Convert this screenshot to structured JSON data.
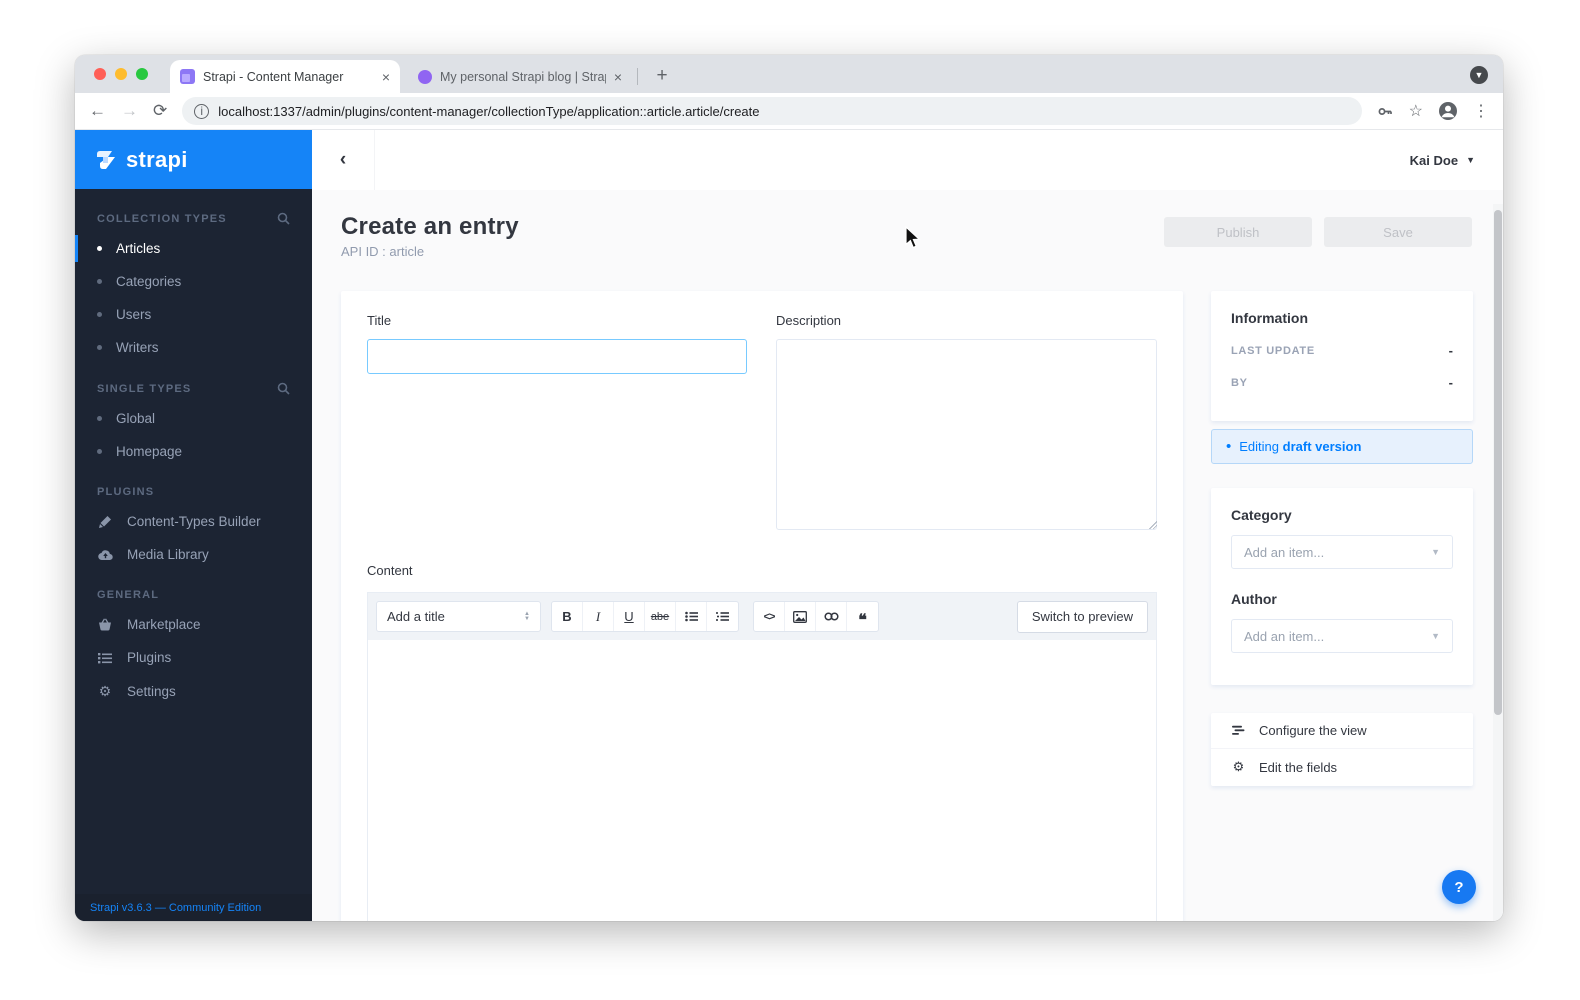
{
  "browser": {
    "tabs": [
      {
        "title": "Strapi - Content Manager"
      },
      {
        "title": "My personal Strapi blog | Strap"
      }
    ],
    "url": "localhost:1337/admin/plugins/content-manager/collectionType/application::article.article/create"
  },
  "sidebar": {
    "logo": "strapi",
    "sections": [
      {
        "label": "COLLECTION TYPES",
        "items": [
          {
            "label": "Articles"
          },
          {
            "label": "Categories"
          },
          {
            "label": "Users"
          },
          {
            "label": "Writers"
          }
        ]
      },
      {
        "label": "SINGLE TYPES",
        "items": [
          {
            "label": "Global"
          },
          {
            "label": "Homepage"
          }
        ]
      },
      {
        "label": "PLUGINS",
        "items": [
          {
            "label": "Content-Types Builder"
          },
          {
            "label": "Media Library"
          }
        ]
      },
      {
        "label": "GENERAL",
        "items": [
          {
            "label": "Marketplace"
          },
          {
            "label": "Plugins"
          },
          {
            "label": "Settings"
          }
        ]
      }
    ],
    "footer": "Strapi v3.6.3 — Community Edition"
  },
  "header": {
    "user": "Kai Doe"
  },
  "page": {
    "title": "Create an entry",
    "subtitle": "API ID : article",
    "publish": "Publish",
    "save": "Save"
  },
  "form": {
    "title_label": "Title",
    "description_label": "Description",
    "content_label": "Content",
    "editor": {
      "heading": "Add a title",
      "bold": "B",
      "italic": "I",
      "underline": "U",
      "strike": "abe",
      "code": "<>",
      "quote": "❝",
      "switch": "Switch to preview"
    }
  },
  "panels": {
    "information": {
      "title": "Information",
      "last_update_label": "LAST UPDATE",
      "last_update_value": "-",
      "by_label": "BY",
      "by_value": "-"
    },
    "draft": {
      "prefix": "Editing",
      "emphasis": "draft version"
    },
    "category": {
      "title": "Category",
      "placeholder": "Add an item..."
    },
    "author": {
      "title": "Author",
      "placeholder": "Add an item..."
    },
    "links": [
      {
        "label": "Configure the view"
      },
      {
        "label": "Edit the fields"
      }
    ]
  },
  "help": {
    "label": "?"
  },
  "colors": {
    "accent": "#1584f7",
    "draft_blue": "#007eff",
    "sidebar_bg": "#1c2433"
  }
}
